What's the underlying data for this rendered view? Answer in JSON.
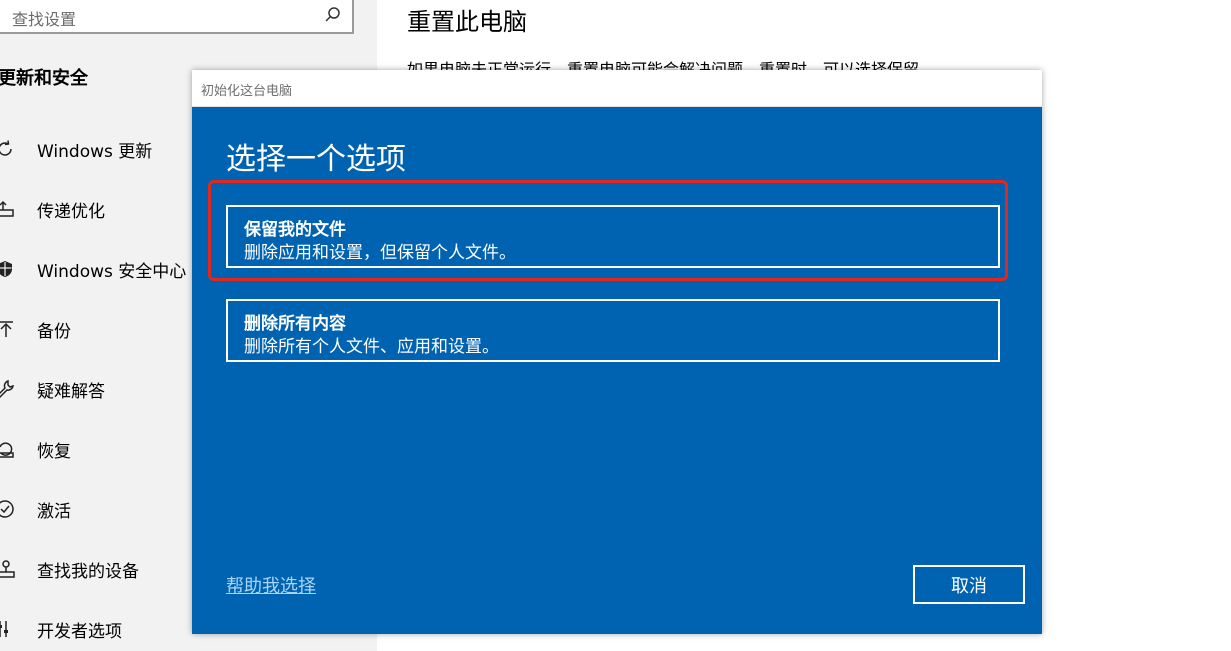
{
  "sidebar": {
    "search": {
      "placeholder": "查找设置"
    },
    "section_title": "更新和安全",
    "items": [
      {
        "label": "Windows 更新",
        "icon": "refresh-icon"
      },
      {
        "label": "传递优化",
        "icon": "delivery-optimization-icon"
      },
      {
        "label": "Windows 安全中心",
        "icon": "shield-icon"
      },
      {
        "label": "备份",
        "icon": "backup-arrow-icon"
      },
      {
        "label": "疑难解答",
        "icon": "wrench-icon"
      },
      {
        "label": "恢复",
        "icon": "recovery-icon"
      },
      {
        "label": "激活",
        "icon": "check-circle-icon"
      },
      {
        "label": "查找我的设备",
        "icon": "find-device-icon"
      },
      {
        "label": "开发者选项",
        "icon": "developer-tools-icon"
      }
    ]
  },
  "main": {
    "title": "重置此电脑",
    "description": "如果电脑未正常运行，重置电脑可能会解决问题。重置时，可以选择保留"
  },
  "dialog": {
    "window_title": "初始化这台电脑",
    "heading": "选择一个选项",
    "options": [
      {
        "title": "保留我的文件",
        "description": "删除应用和设置，但保留个人文件。"
      },
      {
        "title": "删除所有内容",
        "description": "删除所有个人文件、应用和设置。"
      }
    ],
    "help_link": "帮助我选择",
    "cancel_label": "取消"
  },
  "colors": {
    "dialog_bg": "#0063b1",
    "highlight": "#e0281e",
    "sidebar_bg": "#f2f2f2"
  }
}
